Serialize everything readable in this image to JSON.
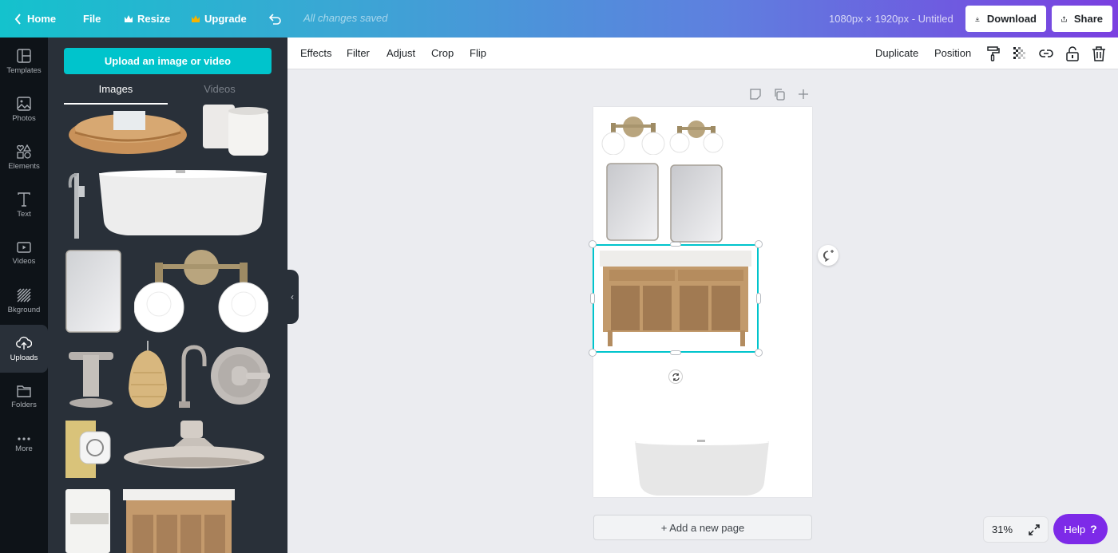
{
  "topbar": {
    "home_label": "Home",
    "file_label": "File",
    "resize_label": "Resize",
    "upgrade_label": "Upgrade",
    "save_status": "All changes saved",
    "document_title": "1080px × 1920px - Untitled",
    "download_label": "Download",
    "share_label": "Share",
    "crown_color": "#f5b300"
  },
  "rail": {
    "items": [
      {
        "label": "Templates",
        "icon": "templates-icon"
      },
      {
        "label": "Photos",
        "icon": "photos-icon"
      },
      {
        "label": "Elements",
        "icon": "elements-icon"
      },
      {
        "label": "Text",
        "icon": "text-icon"
      },
      {
        "label": "Videos",
        "icon": "videos-icon"
      },
      {
        "label": "Bkground",
        "icon": "background-icon"
      },
      {
        "label": "Uploads",
        "icon": "upload-cloud-icon",
        "active": true
      },
      {
        "label": "Folders",
        "icon": "folder-icon"
      },
      {
        "label": "More",
        "icon": "more-icon"
      }
    ]
  },
  "panel": {
    "upload_button": "Upload an image or video",
    "tabs": [
      {
        "label": "Images",
        "active": true
      },
      {
        "label": "Videos",
        "active": false
      }
    ],
    "thumbnails": [
      "rattan-tray",
      "marble-canisters",
      "tub-faucet",
      "freestanding-bathtub",
      "rectangular-mirror",
      "vanity-light-brass",
      "cross-handle-valve",
      "rattan-pendant",
      "gooseneck-faucet",
      "shower-trim-valve",
      "crystal-knob",
      "rain-shower-head",
      "striped-towels",
      "double-vanity"
    ]
  },
  "context_toolbar": {
    "left": [
      "Effects",
      "Filter",
      "Adjust",
      "Crop",
      "Flip"
    ],
    "duplicate_label": "Duplicate",
    "position_label": "Position",
    "icons": [
      "paint-roller-icon",
      "transparency-icon",
      "link-icon",
      "lock-icon",
      "trash-icon"
    ]
  },
  "canvas": {
    "page_icons": [
      "note-icon",
      "duplicate-page-icon",
      "add-page-icon"
    ],
    "elements": [
      "vanity-light-1",
      "vanity-light-2",
      "mirror-1",
      "mirror-2",
      "double-vanity (selected)",
      "freestanding-bathtub"
    ],
    "add_page_label": "+ Add a new page",
    "selection_color": "#00c4cc"
  },
  "footer": {
    "zoom_level": "31%",
    "help_label": "Help",
    "help_glyph": "?",
    "help_color": "#7d2ae8"
  }
}
